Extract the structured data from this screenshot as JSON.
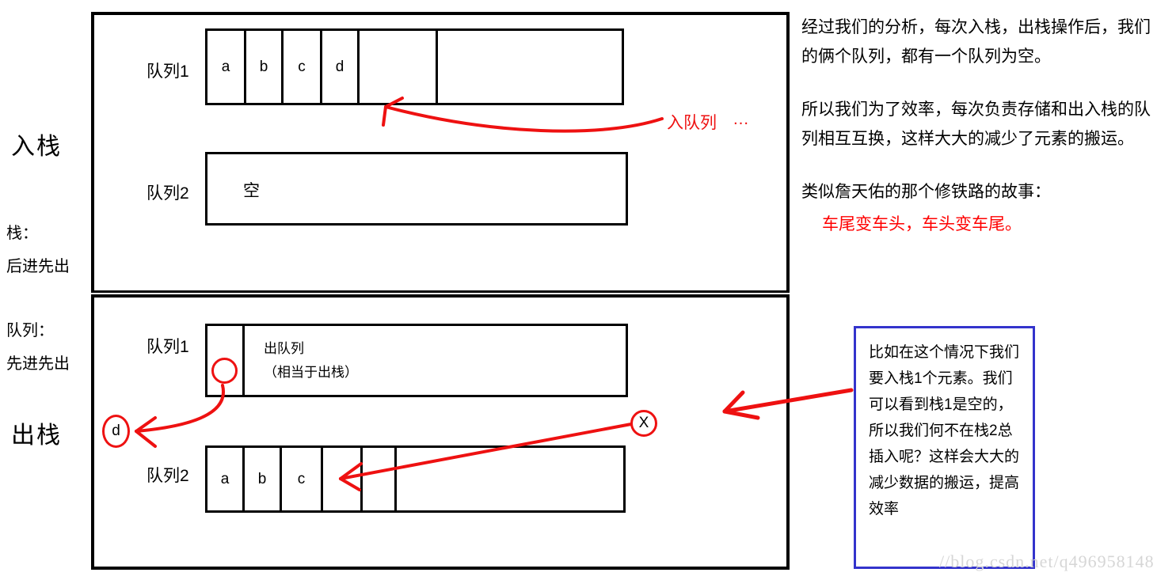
{
  "left_labels": {
    "push_title": "入栈",
    "pop_title": "出栈",
    "stack_note_title": "栈：",
    "stack_note_body": "后进先出",
    "queue_note_title": "队列：",
    "queue_note_body": "先进先出"
  },
  "top_panel": {
    "queue1": {
      "label": "队列1",
      "cells": [
        "a",
        "b",
        "c",
        "d",
        "",
        "",
        ""
      ]
    },
    "queue2": {
      "label": "队列2",
      "content": "空"
    },
    "annotation": {
      "text": "入队列",
      "ellipsis": "…"
    }
  },
  "bottom_panel": {
    "queue1": {
      "label": "队列1",
      "cells": [
        "",
        ""
      ],
      "note_line1": "出队列",
      "note_line2": "（相当于出栈）"
    },
    "queue2": {
      "label": "队列2",
      "cells": [
        "a",
        "b",
        "c",
        "",
        "",
        ""
      ]
    },
    "markers": {
      "popped_element": "d",
      "forbidden": "X"
    }
  },
  "prose": {
    "paragraph1": "经过我们的分析，每次入栈，出栈操作后，我们的俩个队列，都有一个队列为空。",
    "paragraph2": "所以我们为了效率，每次负责存储和出入栈的队列相互互换，这样大大的减少了元素的搬运。",
    "paragraph3": "类似詹天佑的那个修铁路的故事：",
    "red_line": "车尾变车头，车头变车尾。"
  },
  "callout": {
    "text": "比如在这个情况下我们要入栈1个元素。我们可以看到栈1是空的，所以我们何不在栈2总插入呢？这样会大大的减少数据的搬运，提高效率"
  },
  "watermark": "//blog.csdn.net/q496958148",
  "colors": {
    "annotation_red": "#ee1111",
    "callout_border_blue": "#3333cc",
    "watermark_gray": "#d6d6d6",
    "ink_black": "#000000"
  }
}
